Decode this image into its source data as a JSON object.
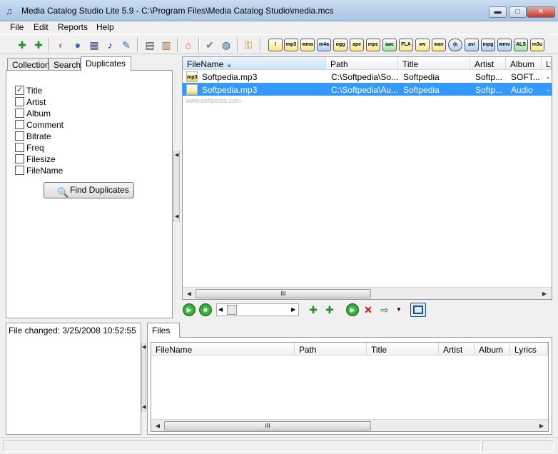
{
  "window": {
    "title": "Media Catalog Studio Lite 5.9 - C:\\Program Files\\Media Catalog Studio\\media.mcs",
    "minimize": "▬",
    "maximize": "□",
    "close": "✕"
  },
  "menu": [
    "File",
    "Edit",
    "Reports",
    "Help"
  ],
  "toolbar": {
    "formats": [
      "!",
      "mp3",
      "wma",
      "m4a",
      "ogg",
      "ape",
      "mpc",
      "aac",
      "FLA",
      "wv",
      "wav",
      "◎",
      "avi",
      "mpg",
      "wmv",
      "ALS",
      "m3u"
    ]
  },
  "left_tabs": [
    {
      "label": "Collection"
    },
    {
      "label": "Search"
    },
    {
      "label": "Duplicates",
      "active": true
    }
  ],
  "duplicates": {
    "fields": [
      {
        "label": "Title",
        "checked": true
      },
      {
        "label": "Artist",
        "checked": false
      },
      {
        "label": "Album",
        "checked": false
      },
      {
        "label": "Comment",
        "checked": false
      },
      {
        "label": "Bitrate",
        "checked": false
      },
      {
        "label": "Freq",
        "checked": false
      },
      {
        "label": "Filesize",
        "checked": false
      },
      {
        "label": "FileName",
        "checked": false
      }
    ],
    "find_label": "Find Duplicates"
  },
  "grid": {
    "columns": [
      "FileName",
      "Path",
      "Title",
      "Artist",
      "Album",
      "Ly"
    ],
    "rows": [
      {
        "filename": "Softpedia.mp3",
        "path": "C:\\Softpedia\\So...",
        "title": "Softpedia",
        "artist": "Softp...",
        "album": "SOFT...",
        "lyrics": "-",
        "selected": false
      },
      {
        "filename": "Softpedia.mp3",
        "path": "C:\\Softpedia\\Au...",
        "title": "Softpedia",
        "artist": "Softp...",
        "album": "Audio",
        "lyrics": "-",
        "selected": true
      }
    ],
    "sort_indicator": "▲",
    "watermark": "www.softpedia.com"
  },
  "status": {
    "file_changed": "File changed: 3/25/2008 10:52:55"
  },
  "files": {
    "tab": "Files",
    "columns": [
      "FileName",
      "Path",
      "Title",
      "Artist",
      "Album",
      "Lyrics"
    ]
  },
  "scroll_grip": "III"
}
